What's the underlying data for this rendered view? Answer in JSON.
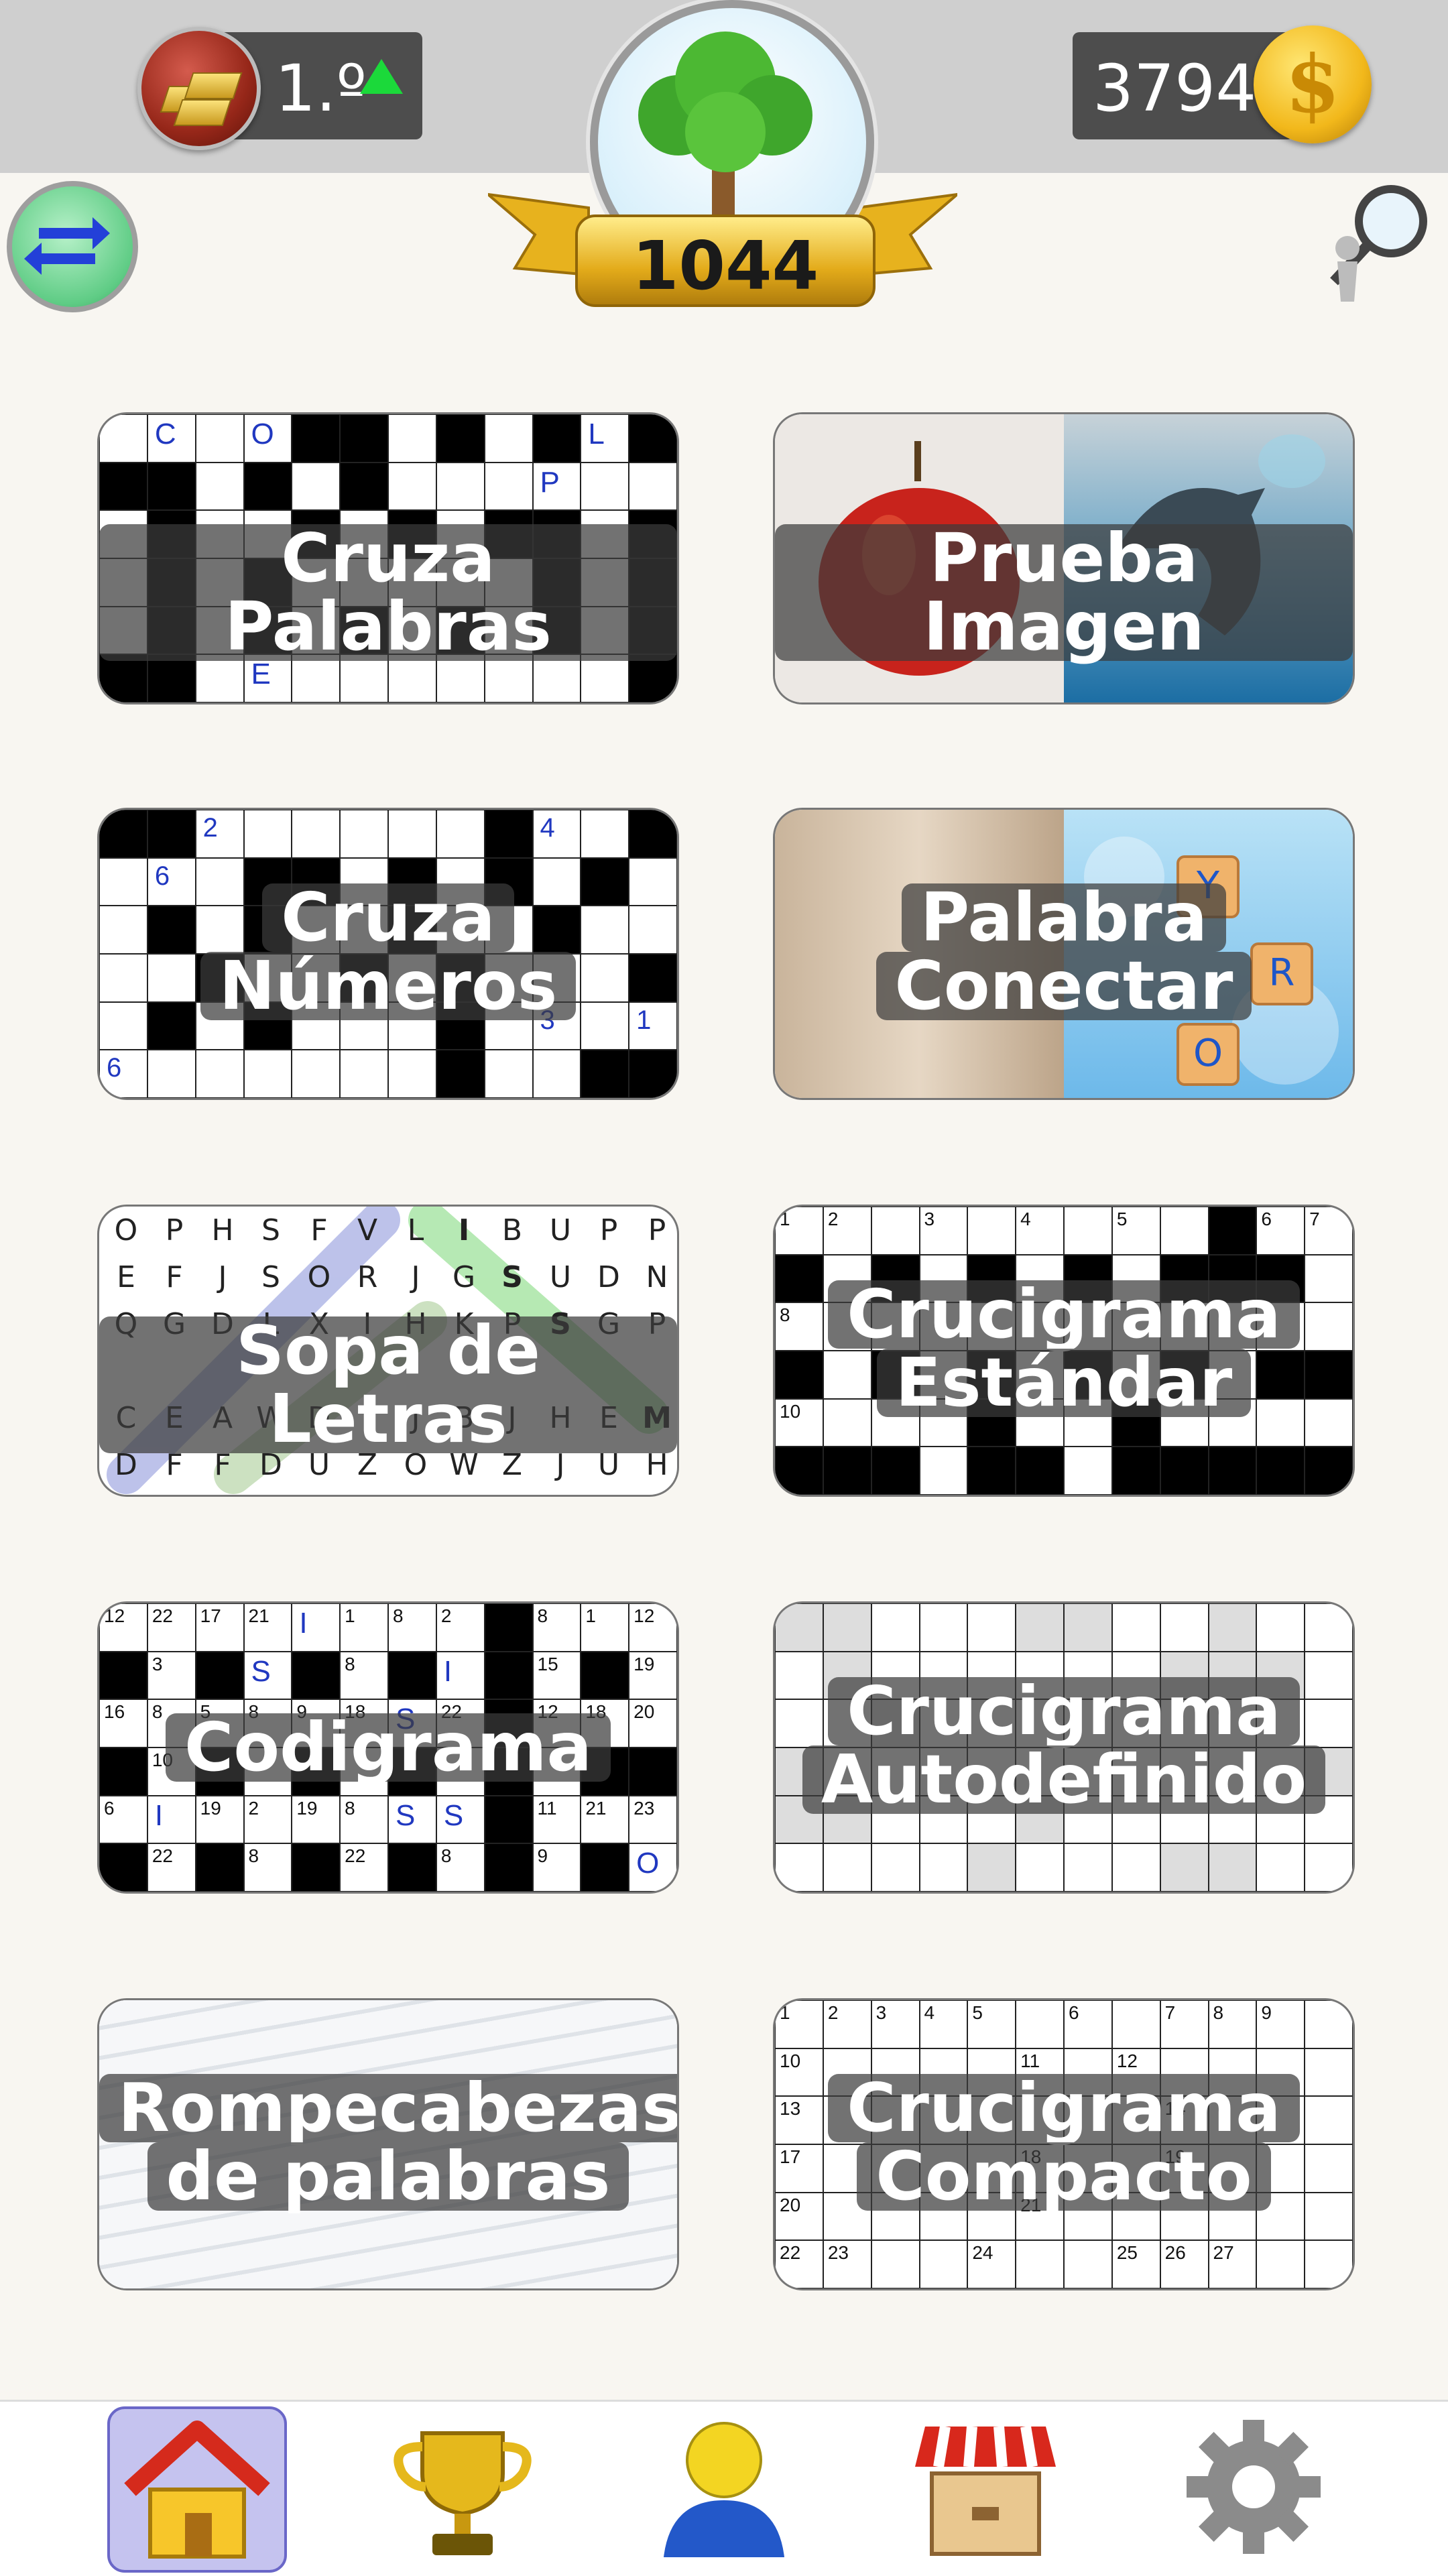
{
  "header": {
    "rank_label": "1.º",
    "coins": "3794",
    "coin_sign": "$",
    "score": "1044"
  },
  "icons": {
    "rank_medal": "gold-bars-medal-icon",
    "rank_up": "up-arrow-icon",
    "coin": "dollar-coin-icon",
    "level": "tree-icon",
    "swap": "swap-arrows-icon",
    "search": "magnifier-person-icon"
  },
  "games": [
    {
      "title_lines": [
        "Cruza Palabras"
      ]
    },
    {
      "title_lines": [
        "Prueba Imagen"
      ]
    },
    {
      "title_lines": [
        "Cruza",
        "Números"
      ]
    },
    {
      "title_lines": [
        "Palabra",
        "Conectar"
      ]
    },
    {
      "title_lines": [
        "Sopa de Letras"
      ]
    },
    {
      "title_lines": [
        "Crucigrama",
        "Estándar"
      ]
    },
    {
      "title_lines": [
        "Codigrama"
      ]
    },
    {
      "title_lines": [
        "Crucigrama",
        "Autodefinido"
      ]
    },
    {
      "title_lines": [
        "Rompecabezas",
        "de palabras"
      ]
    },
    {
      "title_lines": [
        "Crucigrama",
        "Compacto"
      ]
    }
  ],
  "nav": [
    {
      "icon": "home-icon",
      "active": true
    },
    {
      "icon": "trophy-icon",
      "active": false
    },
    {
      "icon": "profile-icon",
      "active": false
    },
    {
      "icon": "shop-icon",
      "active": false
    },
    {
      "icon": "settings-gear-icon",
      "active": false
    }
  ],
  "colors": {
    "topbar": "#cfcfcf",
    "accent_nav": "#c5c3ef",
    "badge_green": "#1bd93a",
    "coin_gold": "#f2b81b"
  }
}
